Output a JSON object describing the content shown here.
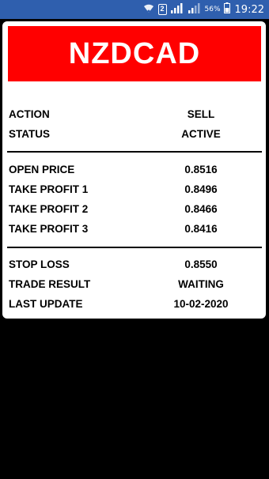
{
  "status_bar": {
    "sim_label": "2",
    "battery": "56%",
    "time": "19:22"
  },
  "pair": "NZDCAD",
  "rows": {
    "action": {
      "label": "ACTION",
      "value": "SELL"
    },
    "status": {
      "label": "STATUS",
      "value": "ACTIVE"
    },
    "open_price": {
      "label": "OPEN PRICE",
      "value": "0.8516"
    },
    "tp1": {
      "label": "TAKE PROFIT 1",
      "value": "0.8496"
    },
    "tp2": {
      "label": "TAKE PROFIT 2",
      "value": "0.8466"
    },
    "tp3": {
      "label": "TAKE PROFIT 3",
      "value": "0.8416"
    },
    "stop_loss": {
      "label": "STOP LOSS",
      "value": "0.8550"
    },
    "trade_result": {
      "label": "TRADE RESULT",
      "value": "WAITING"
    },
    "last_update": {
      "label": "LAST UPDATE",
      "value": "10-02-2020"
    }
  },
  "colors": {
    "header_bg": "#ff0000",
    "status_bar_bg": "#2f5fae"
  }
}
